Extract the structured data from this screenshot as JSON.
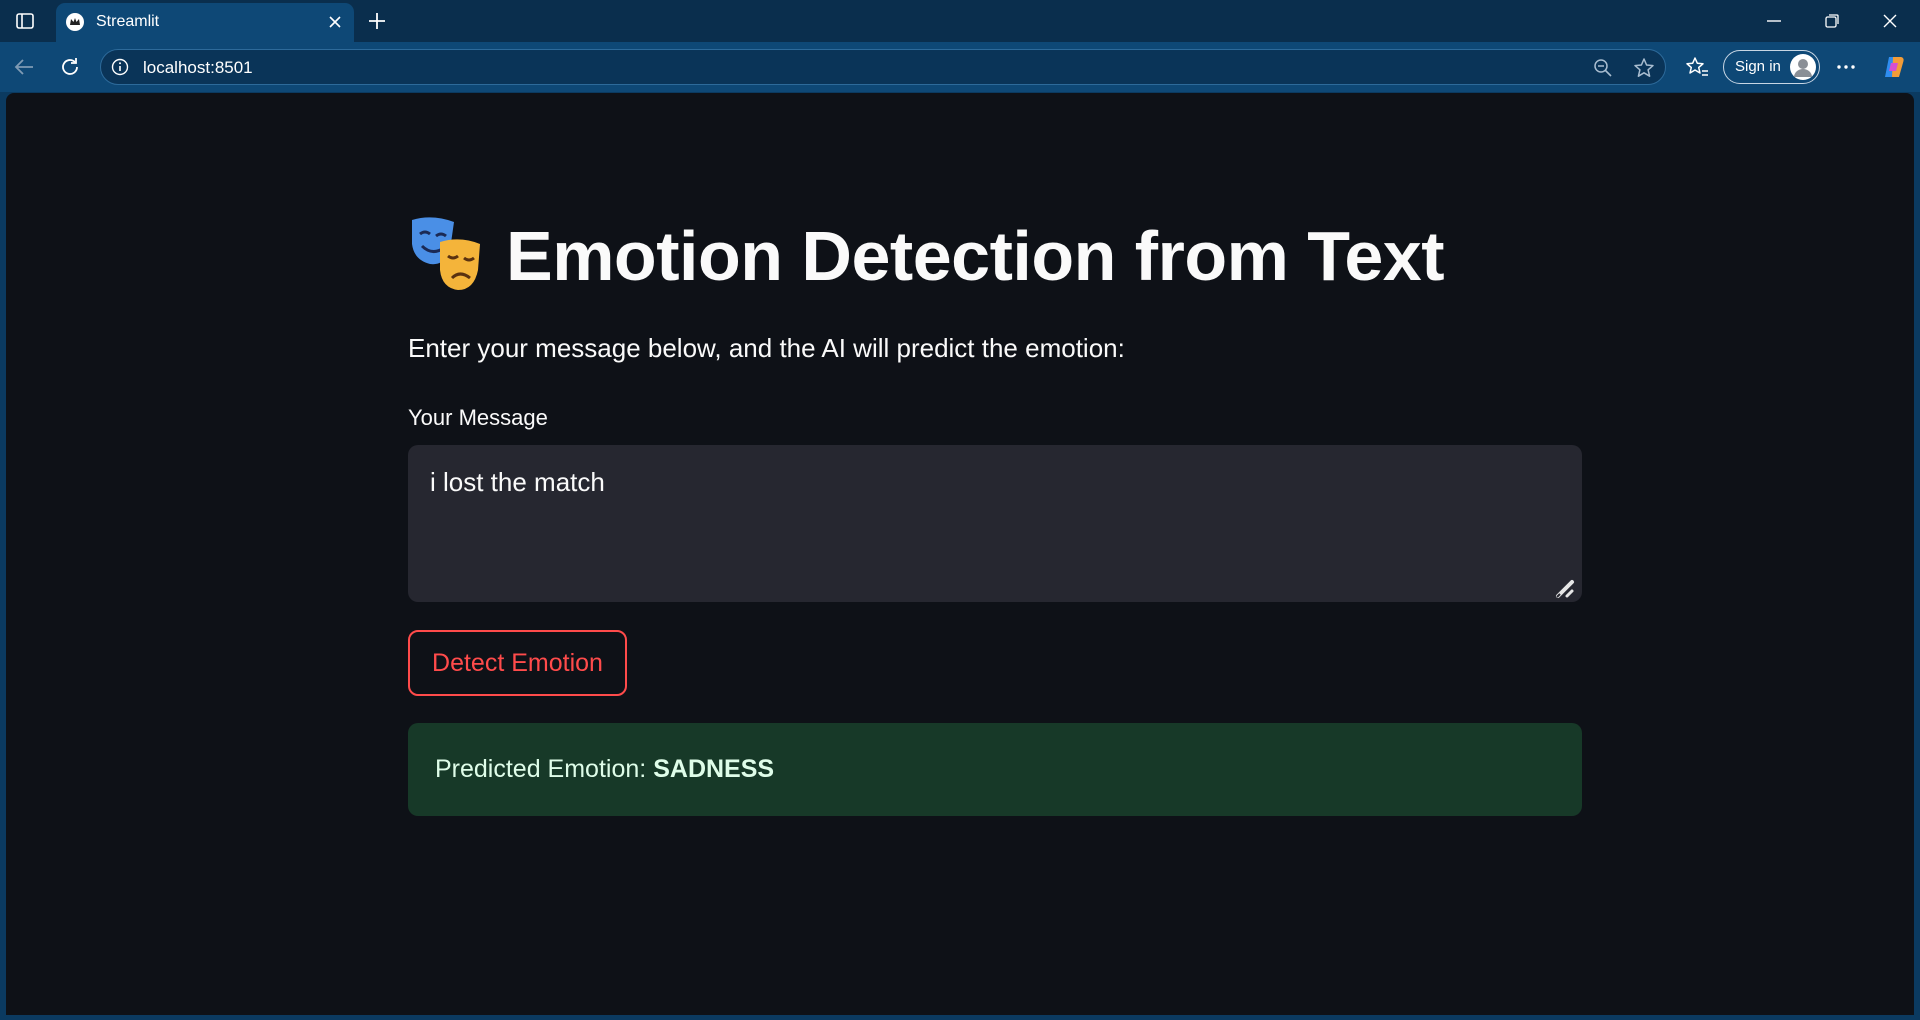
{
  "browser": {
    "tab_title": "Streamlit",
    "url": "localhost:8501",
    "signin_label": "Sign in",
    "icons": [
      "sidebar-toggle-icon",
      "streamlit-favicon",
      "close-icon",
      "plus-icon",
      "minimize-icon",
      "restore-icon",
      "window-close-icon",
      "back-arrow-icon",
      "refresh-icon",
      "info-icon",
      "zoom-out-icon",
      "star-icon",
      "favorites-icon",
      "profile-icon",
      "more-icon",
      "copilot-icon"
    ]
  },
  "app": {
    "title_emoji": "🎭",
    "title": "Emotion Detection from Text",
    "subtitle": "Enter your message below, and the AI will predict the emotion:",
    "input_label": "Your Message",
    "input_value": "i lost the match",
    "button_label": "Detect Emotion",
    "result_prefix": "Predicted Emotion:",
    "result_value": "SADNESS",
    "colors": {
      "accent": "#ff4b4b",
      "success_bg": "#173928",
      "page_bg": "#0e1117",
      "input_bg": "#262730"
    }
  }
}
